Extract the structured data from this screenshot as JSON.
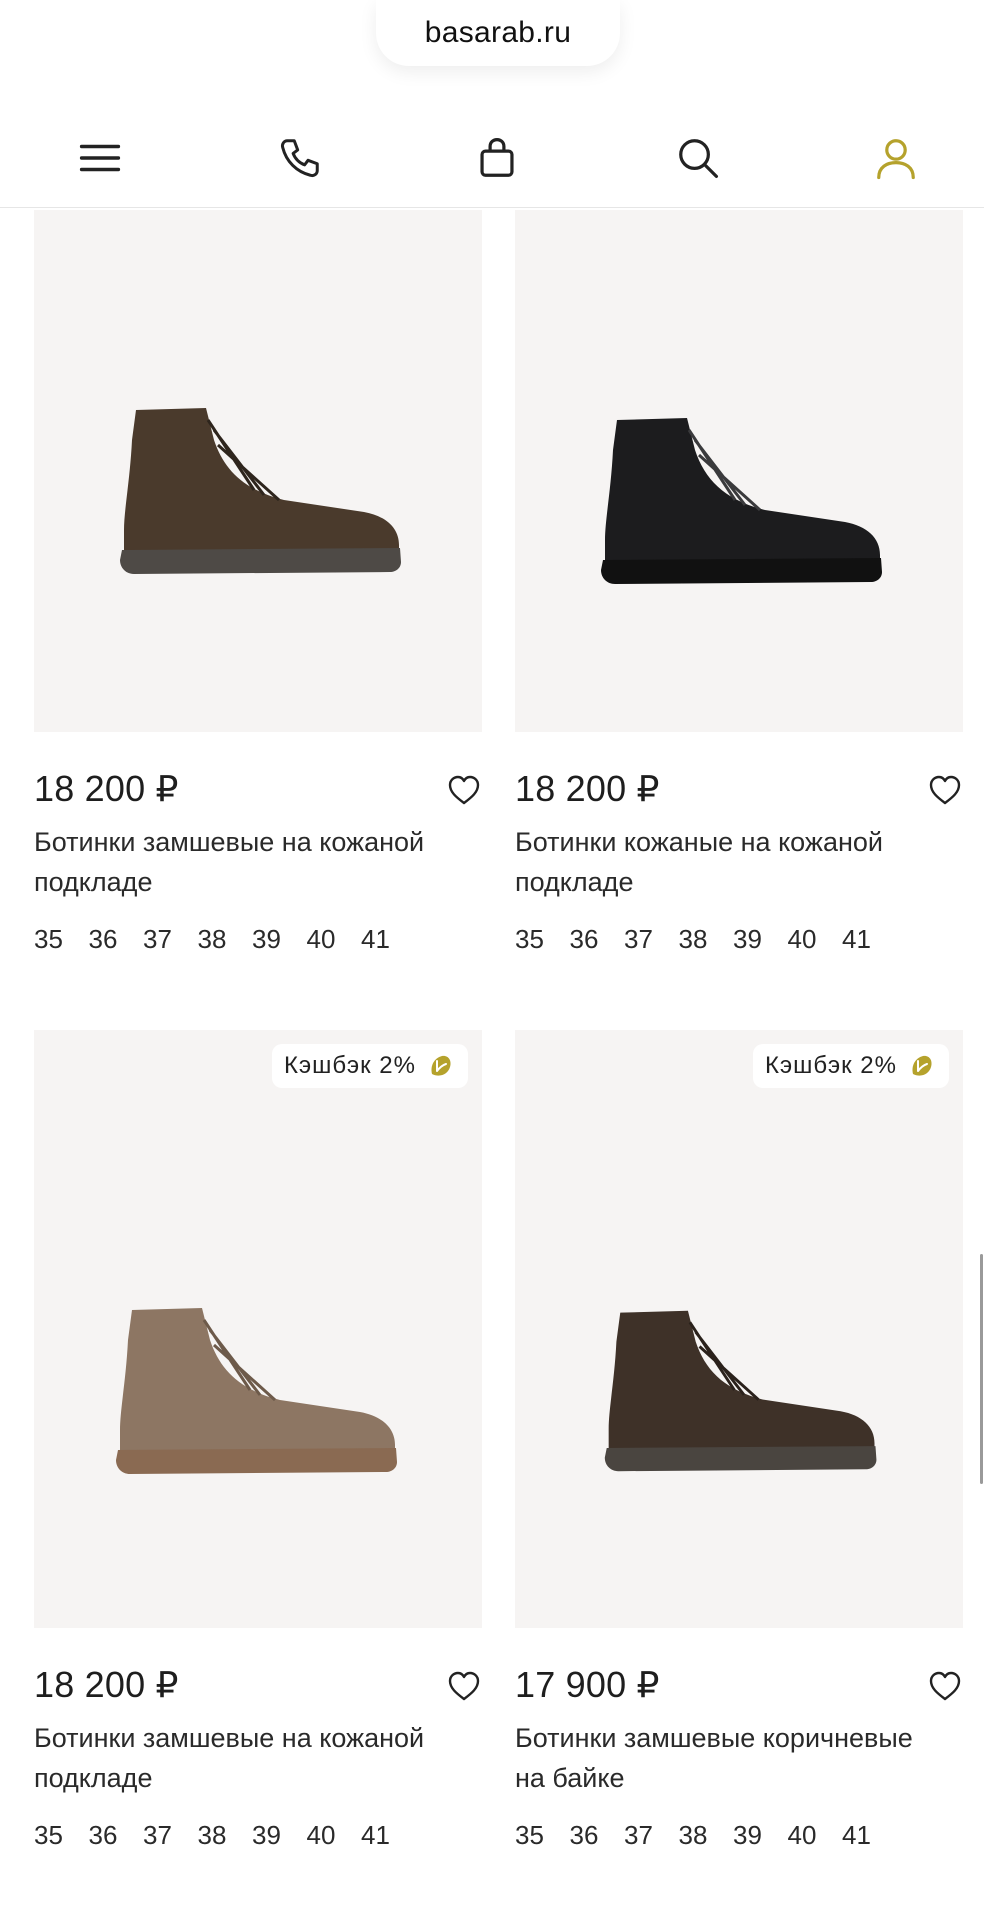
{
  "browser": {
    "url": "basarab.ru"
  },
  "nav": {
    "menu_icon": "menu-icon",
    "phone_icon": "phone-icon",
    "cart_icon": "bag-icon",
    "search_icon": "search-icon",
    "account_icon": "user-icon",
    "account_color": "#b5a22c"
  },
  "products": [
    {
      "price": "18 200 ₽",
      "title": "Ботинки замшевые на кожаной подкладе",
      "sizes": [
        "35",
        "36",
        "37",
        "38",
        "39",
        "40",
        "41"
      ],
      "badge": "",
      "boot_color": "#4a3a2c"
    },
    {
      "price": "18 200 ₽",
      "title": "Ботинки кожаные на кожаной подкладе",
      "sizes": [
        "35",
        "36",
        "37",
        "38",
        "39",
        "40",
        "41"
      ],
      "badge": "",
      "boot_color": "#1c1c1e"
    },
    {
      "price": "18 200 ₽",
      "title": "Ботинки замшевые на кожаной подкладе",
      "sizes": [
        "35",
        "36",
        "37",
        "38",
        "39",
        "40",
        "41"
      ],
      "badge": "Кэшбэк 2%",
      "boot_color": "#8d7663"
    },
    {
      "price": "17 900 ₽",
      "title": "Ботинки замшевые коричневые на байке",
      "sizes": [
        "35",
        "36",
        "37",
        "38",
        "39",
        "40",
        "41"
      ],
      "badge": "Кэшбэк 2%",
      "boot_color": "#3e3128"
    }
  ],
  "colors": {
    "accent": "#b5a22c",
    "photo_bg": "#f6f4f3"
  }
}
